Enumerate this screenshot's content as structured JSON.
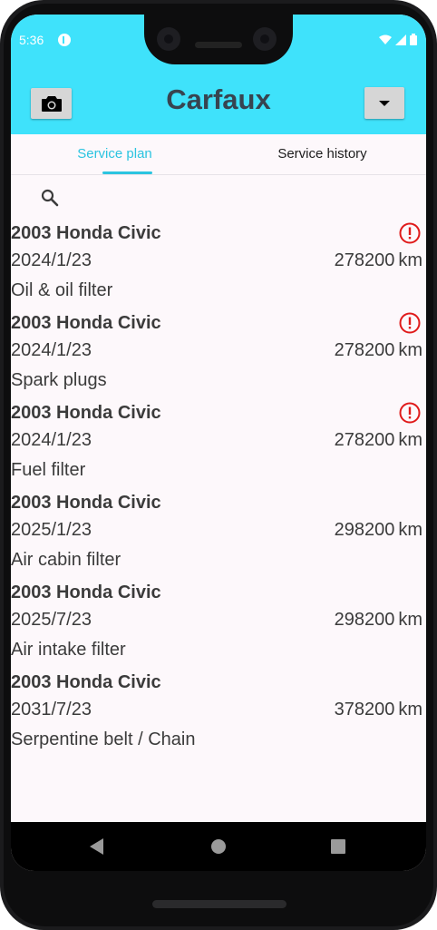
{
  "status_bar": {
    "time": "5:36"
  },
  "app": {
    "title": "Carfaux"
  },
  "tabs": [
    {
      "label": "Service plan",
      "selected": true
    },
    {
      "label": "Service history",
      "selected": false
    }
  ],
  "colors": {
    "header": "#3fe2fb",
    "accent": "#2bc4e0",
    "alert": "#e01b1b",
    "text": "#3b3b3b"
  },
  "icons": {
    "camera": "camera-icon",
    "dropdown": "caret-down-icon",
    "search": "search-icon",
    "alert": "exclamation-circle-icon"
  },
  "services": [
    {
      "vehicle": "2003 Honda Civic",
      "date": "2024/1/23",
      "mileage": "278200 km",
      "task": "Oil & oil filter",
      "overdue": true
    },
    {
      "vehicle": "2003 Honda Civic",
      "date": "2024/1/23",
      "mileage": "278200 km",
      "task": "Spark plugs",
      "overdue": true
    },
    {
      "vehicle": "2003 Honda Civic",
      "date": "2024/1/23",
      "mileage": "278200 km",
      "task": "Fuel filter",
      "overdue": true
    },
    {
      "vehicle": "2003 Honda Civic",
      "date": "2025/1/23",
      "mileage": "298200 km",
      "task": "Air cabin filter",
      "overdue": false
    },
    {
      "vehicle": "2003 Honda Civic",
      "date": "2025/7/23",
      "mileage": "298200 km",
      "task": "Air intake filter",
      "overdue": false
    },
    {
      "vehicle": "2003 Honda Civic",
      "date": "2031/7/23",
      "mileage": "378200 km",
      "task": "Serpentine belt / Chain",
      "overdue": false
    }
  ]
}
